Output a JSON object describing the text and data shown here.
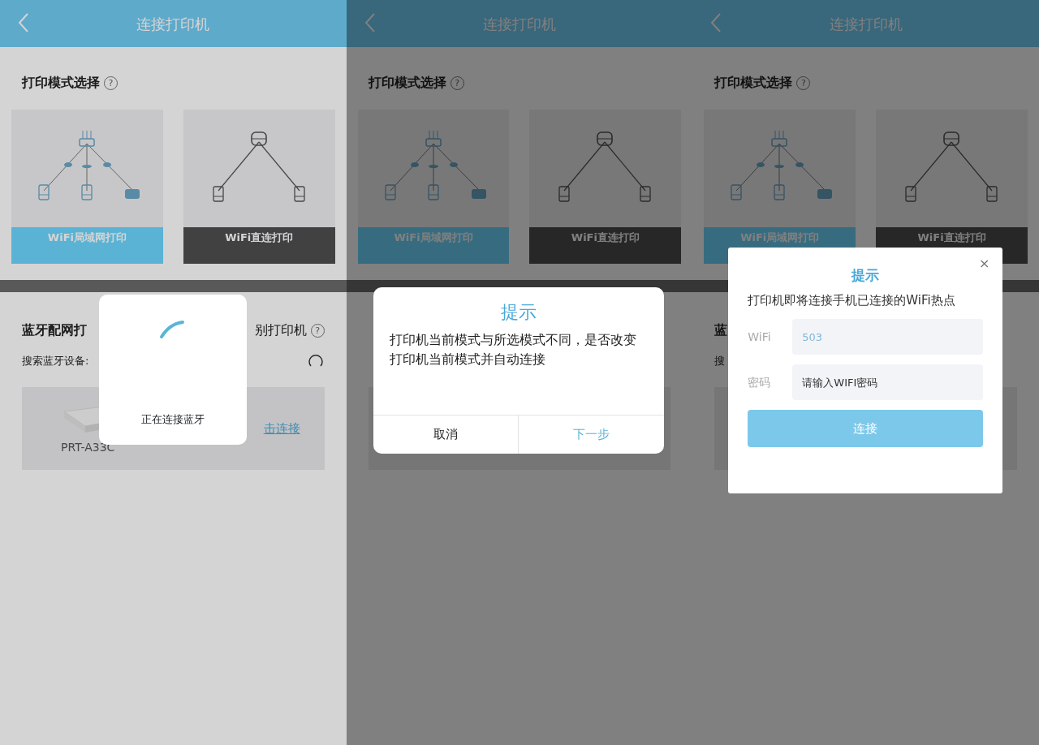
{
  "screens": [
    {
      "header": {
        "title": "连接打印机"
      },
      "mode_section": {
        "title": "打印模式选择",
        "help": "?",
        "modes": [
          {
            "kind": "router",
            "label": "WiFi局域网打印",
            "selected": true
          },
          {
            "kind": "direct",
            "label": "WiFi直连打印",
            "selected": false
          }
        ]
      },
      "bluetooth_section": {
        "title": "蓝牙配网打",
        "title_right": "别打印机",
        "help": "?",
        "search_label": "搜索蓝牙设备:",
        "device": {
          "name": "PRT-A33C",
          "action": "击连接"
        }
      },
      "dialog": {
        "kind": "loading",
        "message": "正在连接蓝牙"
      }
    },
    {
      "header": {
        "title": "连接打印机"
      },
      "mode_section": {
        "title": "打印模式选择",
        "help": "?",
        "modes": [
          {
            "kind": "router",
            "label": "WiFi局域网打印",
            "selected": true
          },
          {
            "kind": "direct",
            "label": "WiFi直连打印",
            "selected": false
          }
        ]
      },
      "dialog": {
        "kind": "confirm",
        "title": "提示",
        "message": "打印机当前模式与所选模式不同，是否改变打印机当前模式并自动连接",
        "buttons": [
          {
            "label": "取消",
            "primary": false
          },
          {
            "label": "下一步",
            "primary": true
          }
        ]
      }
    },
    {
      "header": {
        "title": "连接打印机"
      },
      "mode_section": {
        "title": "打印模式选择",
        "help": "?",
        "modes": [
          {
            "kind": "router",
            "label": "WiFi局域网打印",
            "selected": true
          },
          {
            "kind": "direct",
            "label": "WiFi直连打印",
            "selected": false
          }
        ]
      },
      "bluetooth_section": {
        "title": "蓝",
        "search_label": "搜"
      },
      "dialog": {
        "kind": "form",
        "title": "提示",
        "close": "×",
        "message": "打印机即将连接手机已连接的WiFi热点",
        "fields": [
          {
            "label": "WiFi",
            "value": "503"
          },
          {
            "label": "密码",
            "placeholder": "请输入WIFI密码"
          }
        ],
        "button": "连接"
      }
    }
  ]
}
